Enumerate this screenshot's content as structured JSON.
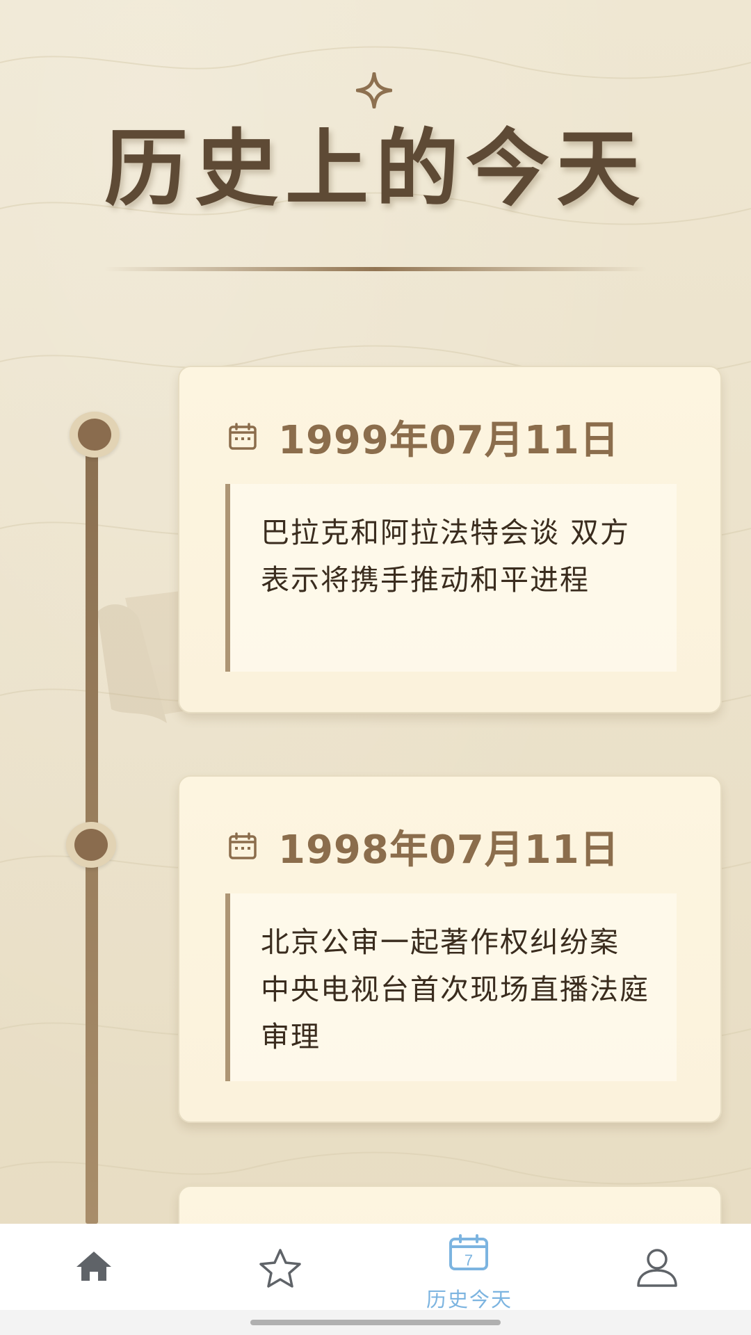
{
  "header": {
    "title": "历史上的今天"
  },
  "events": [
    {
      "date": "1999年07月11日",
      "text": "巴拉克和阿拉法特会谈 双方表示将携手推动和平进程"
    },
    {
      "date": "1998年07月11日",
      "text": "北京公审一起著作权纠纷案 中央电视台首次现场直播法庭审理"
    }
  ],
  "bottom_nav": {
    "items": [
      {
        "icon": "home-icon",
        "label": "",
        "active": false
      },
      {
        "icon": "star-icon",
        "label": "",
        "active": false
      },
      {
        "icon": "calendar-7-icon",
        "label": "历史今天",
        "active": true
      },
      {
        "icon": "person-icon",
        "label": "",
        "active": false
      }
    ]
  },
  "colors": {
    "background": "#ece3cc",
    "title": "#5e4a35",
    "accent_brown": "#8b6d4c",
    "card": "#fdf5e0",
    "nav_active": "#7cb4e0",
    "nav_inactive": "#5f6368"
  }
}
